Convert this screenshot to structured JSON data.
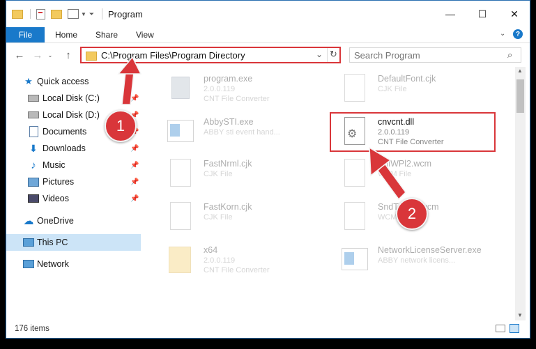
{
  "window": {
    "title": "Program",
    "controls": {
      "minimize": "—",
      "maximize": "☐",
      "close": "✕"
    }
  },
  "ribbon": {
    "tabs": [
      {
        "label": "File"
      },
      {
        "label": "Home"
      },
      {
        "label": "Share"
      },
      {
        "label": "View"
      }
    ]
  },
  "address": {
    "path": "C:\\Program Files\\Program Directory"
  },
  "search": {
    "placeholder": "Search Program"
  },
  "sidebar": {
    "items": [
      {
        "label": "Quick access",
        "icon": "star-icon",
        "pinned": false
      },
      {
        "label": "Local Disk (C:)",
        "icon": "drive-icon",
        "pinned": true
      },
      {
        "label": "Local Disk (D:)",
        "icon": "drive-icon",
        "pinned": true
      },
      {
        "label": "Documents",
        "icon": "documents-icon",
        "pinned": true
      },
      {
        "label": "Downloads",
        "icon": "download-icon",
        "pinned": true
      },
      {
        "label": "Music",
        "icon": "music-icon",
        "pinned": true
      },
      {
        "label": "Pictures",
        "icon": "pictures-icon",
        "pinned": true
      },
      {
        "label": "Videos",
        "icon": "videos-icon",
        "pinned": true
      },
      {
        "label": "OneDrive",
        "icon": "cloud-icon",
        "pinned": false
      },
      {
        "label": "This PC",
        "icon": "computer-icon",
        "pinned": false,
        "selected": true
      },
      {
        "label": "Network",
        "icon": "network-icon",
        "pinned": false
      }
    ]
  },
  "files": [
    {
      "name": "program.exe",
      "line1": "2.0.0.119",
      "line2": "CNT File Converter",
      "icon": "exe-icon"
    },
    {
      "name": "DefaultFont.cjk",
      "line1": "CJK File",
      "line2": "",
      "icon": "file-icon"
    },
    {
      "name": "AbbySTI.exe",
      "line1": "ABBY sti event hand...",
      "line2": "",
      "icon": "app-window-icon"
    },
    {
      "name": "cnvcnt.dll",
      "line1": "2.0.0.119",
      "line2": "CNT File Converter",
      "icon": "dll-gear-icon",
      "highlighted": true
    },
    {
      "name": "FastNrml.cjk",
      "line1": "CJK File",
      "line2": "",
      "icon": "file-icon"
    },
    {
      "name": "SnlWPl2.wcm",
      "line1": "WCM File",
      "line2": "",
      "icon": "file-icon"
    },
    {
      "name": "FastKorn.cjk",
      "line1": "CJK File",
      "line2": "",
      "icon": "file-icon"
    },
    {
      "name": "SndToWPl.wcm",
      "line1": "WCM File",
      "line2": "",
      "icon": "file-icon"
    },
    {
      "name": "x64",
      "line1": "2.0.0.119",
      "line2": "CNT File Converter",
      "icon": "folder-zip-icon"
    },
    {
      "name": "NetworkLicenseServer.exe",
      "line1": "ABBY network licens...",
      "line2": "",
      "icon": "app-window-icon"
    }
  ],
  "status": {
    "count": "176 items"
  },
  "annotations": [
    {
      "number": "1"
    },
    {
      "number": "2"
    }
  ],
  "colors": {
    "accent": "#1979ca",
    "highlight": "#d9363a",
    "selection": "#cce4f7"
  }
}
